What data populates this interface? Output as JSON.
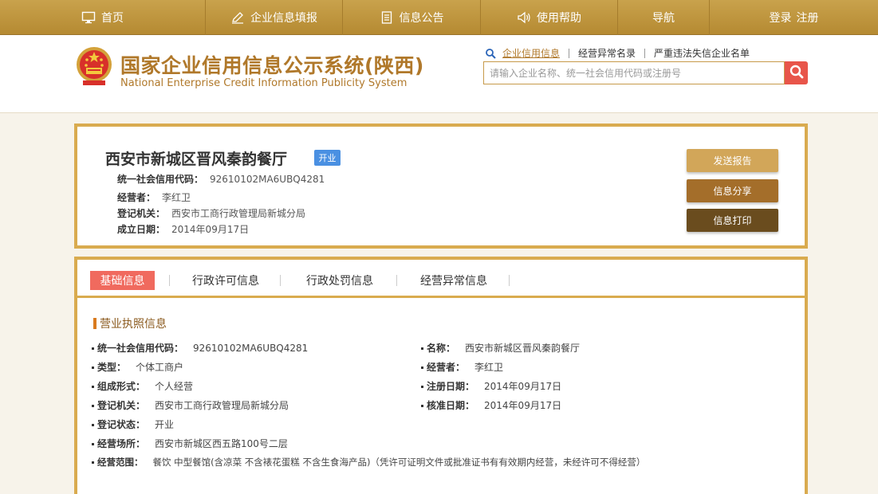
{
  "nav": {
    "items": [
      {
        "label": "首页",
        "icon": "monitor-icon"
      },
      {
        "label": "企业信息填报",
        "icon": "pen-icon"
      },
      {
        "label": "信息公告",
        "icon": "document-icon"
      },
      {
        "label": "使用帮助",
        "icon": "speaker-icon"
      },
      {
        "label": "导航",
        "icon": ""
      }
    ],
    "login_label": "登录",
    "register_label": "注册"
  },
  "header": {
    "title": "国家企业信用信息公示系统(陕西)",
    "subtitle": "National Enterprise Credit Information Publicity System"
  },
  "search": {
    "links": [
      "企业信用信息",
      "经营异常名录",
      "严重违法失信企业名单"
    ],
    "placeholder": "请输入企业名称、统一社会信用代码或注册号"
  },
  "enterprise": {
    "name": "西安市新城区晋风秦韵餐厅",
    "status": "开业",
    "rows": [
      {
        "label": "统一社会信用代码：",
        "value": "92610102MA6UBQ4281"
      },
      {
        "label": "经营者：",
        "value": "李红卫"
      },
      {
        "label": "登记机关：",
        "value": "西安市工商行政管理局新城分局"
      },
      {
        "label": "成立日期：",
        "value": "2014年09月17日"
      }
    ],
    "buttons": {
      "send": "发送报告",
      "share": "信息分享",
      "print": "信息打印"
    }
  },
  "tabs": [
    "基础信息",
    "行政许可信息",
    "行政处罚信息",
    "经营异常信息"
  ],
  "license": {
    "section_title": "营业执照信息",
    "left": [
      {
        "label": "统一社会信用代码：",
        "value": "92610102MA6UBQ4281"
      },
      {
        "label": "类型：",
        "value": "个体工商户"
      },
      {
        "label": "组成形式：",
        "value": "个人经营"
      },
      {
        "label": "登记机关：",
        "value": "西安市工商行政管理局新城分局"
      },
      {
        "label": "登记状态：",
        "value": "开业"
      },
      {
        "label": "经营场所：",
        "value": "西安市新城区西五路100号二层"
      },
      {
        "label": "经营范围：",
        "value": "餐饮 中型餐馆(含凉菜 不含裱花蛋糕 不含生食海产品)（凭许可证明文件或批准证书有有效期内经营，未经许可不得经营）"
      }
    ],
    "right": [
      {
        "label": "名称：",
        "value": "西安市新城区晋风秦韵餐厅"
      },
      {
        "label": "经营者：",
        "value": "李红卫"
      },
      {
        "label": "注册日期：",
        "value": "2014年09月17日"
      },
      {
        "label": "核准日期：",
        "value": "2014年09月17日"
      }
    ]
  },
  "colors": {
    "nav_gold": "#c9a24c",
    "title_gold": "#b0782a",
    "border_gold": "#d9ab4f",
    "active_tab": "#f06a5e",
    "status_blue": "#4a90e2"
  }
}
